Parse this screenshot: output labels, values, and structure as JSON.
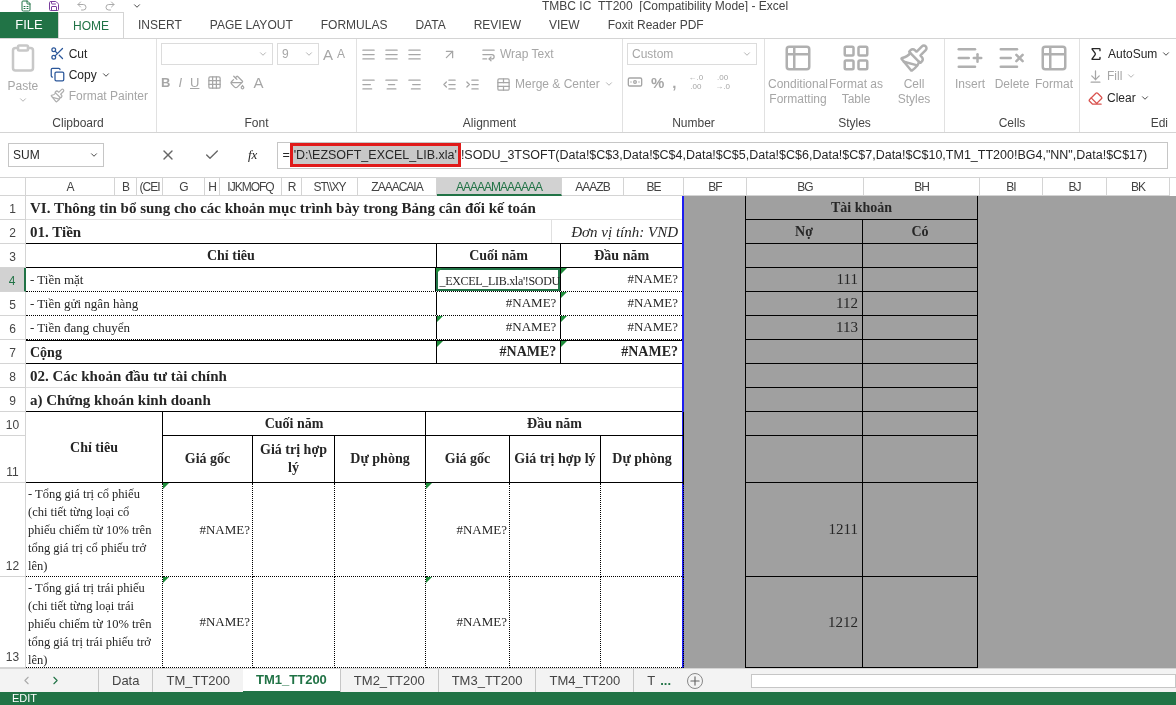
{
  "title_bar": {
    "text": "TMBC IC_TT200  [Compatibility Mode] - Excel"
  },
  "ribbon_tabs": [
    {
      "label": "FILE",
      "kind": "file",
      "selected": false
    },
    {
      "label": "HOME",
      "kind": "tab",
      "selected": true
    },
    {
      "label": "INSERT",
      "kind": "tab",
      "selected": false
    },
    {
      "label": "PAGE LAYOUT",
      "kind": "tab",
      "selected": false
    },
    {
      "label": "FORMULAS",
      "kind": "tab",
      "selected": false
    },
    {
      "label": "DATA",
      "kind": "tab",
      "selected": false
    },
    {
      "label": "REVIEW",
      "kind": "tab",
      "selected": false
    },
    {
      "label": "VIEW",
      "kind": "tab",
      "selected": false
    },
    {
      "label": "Foxit Reader PDF",
      "kind": "tab",
      "selected": false
    }
  ],
  "ribbon": {
    "clipboard": {
      "label": "Clipboard",
      "paste": {
        "label": "Paste",
        "disabled": true
      },
      "cut": {
        "label": "Cut",
        "disabled": false
      },
      "copy": {
        "label": "Copy",
        "disabled": false
      },
      "format_painter": {
        "label": "Format Painter",
        "disabled": true
      }
    },
    "font": {
      "label": "Font",
      "disabled": true,
      "font_size": "9",
      "size_buttons": [
        "A",
        "A"
      ],
      "style_buttons": [
        "B",
        "I",
        "U"
      ],
      "font_color": "A"
    },
    "alignment": {
      "label": "Alignment",
      "disabled": true,
      "wrap_text": "Wrap Text",
      "merge_center": "Merge & Center"
    },
    "number": {
      "label": "Number",
      "disabled": true,
      "format": "Custom",
      "buttons": [
        "%",
        ","
      ],
      "decimal_buttons": [
        {
          "top": "←.0",
          "bottom": ".00"
        },
        {
          "top": ".00",
          "bottom": "→.0"
        }
      ]
    },
    "styles": {
      "label": "Styles",
      "disabled": true,
      "buttons": [
        {
          "top": "Conditional",
          "bottom": "Formatting"
        },
        {
          "top": "Format as",
          "bottom": "Table"
        },
        {
          "top": "Cell",
          "bottom": "Styles"
        }
      ]
    },
    "cells": {
      "label": "Cells",
      "disabled": true,
      "buttons": [
        "Insert",
        "Delete",
        "Format"
      ]
    },
    "editing": {
      "label": "Edi",
      "autosum": {
        "label": "AutoSum",
        "disabled": false
      },
      "fill": {
        "label": "Fill",
        "disabled": true
      },
      "clear": {
        "label": "Clear",
        "disabled": false
      }
    }
  },
  "formula_bar": {
    "name_box": "SUM",
    "function_label": "fx",
    "prefix": "=",
    "highlighted": "'D:\\EZSOFT_EXCEL_LIB.xla'",
    "rest": "!SODU_3TSOFT(Data!$C$3,Data!$C$4,Data!$C$5,Data!$C$6,Data!$C$7,Data!$C$10,TM1_TT200!BG4,\"NN\",Data!$C$17)"
  },
  "column_headers": [
    {
      "label": "A",
      "selected": false
    },
    {
      "label": "B",
      "selected": false
    },
    {
      "label": "(CEI",
      "selected": false
    },
    {
      "label": "G",
      "selected": false
    },
    {
      "label": "H",
      "selected": false
    },
    {
      "label": "IJKMOFQ",
      "selected": false
    },
    {
      "label": "R",
      "selected": false
    },
    {
      "label": "ST\\\\XY",
      "selected": false
    },
    {
      "label": "ZAAACAIA",
      "selected": false
    },
    {
      "label": "AAAAAMAAAAAA",
      "selected": true
    },
    {
      "label": "AAAZB",
      "selected": false
    },
    {
      "label": "BE",
      "selected": false
    },
    {
      "label": "BF",
      "selected": false
    },
    {
      "label": "BG",
      "selected": false
    },
    {
      "label": "BH",
      "selected": false
    },
    {
      "label": "BI",
      "selected": false
    },
    {
      "label": "BJ",
      "selected": false
    },
    {
      "label": "BK",
      "selected": false
    }
  ],
  "row_headers": [
    {
      "label": "1",
      "selected": false
    },
    {
      "label": "2",
      "selected": false
    },
    {
      "label": "3",
      "selected": false
    },
    {
      "label": "4",
      "selected": true
    },
    {
      "label": "5",
      "selected": false
    },
    {
      "label": "6",
      "selected": false
    },
    {
      "label": "7",
      "selected": false
    },
    {
      "label": "8",
      "selected": false
    },
    {
      "label": "9",
      "selected": false
    },
    {
      "label": "10",
      "selected": false
    },
    {
      "label": "11",
      "selected": false
    },
    {
      "label": "12",
      "selected": false
    },
    {
      "label": "13",
      "selected": false
    }
  ],
  "sheet": {
    "title": "VI. Thông tin bổ sung cho các khoản mục trình bày trong Bảng cân đối kế toán",
    "section_1": {
      "heading": "01. Tiền",
      "unit": "Đơn vị tính: VND"
    },
    "table_1": {
      "columns": [
        "Chỉ tiêu",
        "Cuối năm",
        "Đầu năm"
      ],
      "rows": [
        {
          "label": "- Tiền mặt",
          "total": false,
          "values": [
            {
              "text": "_EXCEL_LIB.xla'!SODU",
              "selected": true,
              "flag": true
            },
            {
              "text": "#NAME?",
              "selected": false,
              "flag": true
            }
          ]
        },
        {
          "label": "- Tiền gửi ngân hàng",
          "total": false,
          "values": [
            {
              "text": "#NAME?",
              "selected": false,
              "flag": false
            },
            {
              "text": "#NAME?",
              "selected": false,
              "flag": true
            }
          ]
        },
        {
          "label": "- Tiền đang chuyển",
          "total": false,
          "values": [
            {
              "text": "#NAME?",
              "selected": false,
              "flag": true
            },
            {
              "text": "#NAME?",
              "selected": false,
              "flag": true
            }
          ]
        },
        {
          "label": "Cộng",
          "total": true,
          "values": [
            {
              "text": "#NAME?",
              "selected": false,
              "flag": true
            },
            {
              "text": "#NAME?",
              "selected": false,
              "flag": true
            }
          ]
        }
      ]
    },
    "section_2": "02. Các khoản đầu tư tài chính",
    "subsection": "a) Chứng khoán kinh doanh",
    "table_2": {
      "label_header": "Chỉ tiêu",
      "groups": [
        {
          "label": "Cuối năm",
          "columns": [
            "Giá gốc",
            "Giá trị hợp lý",
            "Dự phòng"
          ]
        },
        {
          "label": "Đầu năm",
          "columns": [
            "Giá gốc",
            "Giá trị hợp lý",
            "Dự phòng"
          ]
        }
      ],
      "rows": [
        {
          "label": "- Tổng giá trị cổ phiếu (chi tiết từng loại cổ phiếu chiếm từ 10% trên tổng giá trị cổ phiếu trở lên)",
          "cells": [
            {
              "text": "#NAME?",
              "flag": true
            },
            {
              "flag": false
            },
            {
              "flag": false
            },
            {
              "text": "#NAME?",
              "flag": true
            },
            {
              "flag": false
            },
            {
              "flag": false
            }
          ]
        },
        {
          "label": "- Tổng giá trị trái phiếu (chi tiết từng loại trái phiếu chiếm từ 10% trên tổng giá trị trái phiếu trở lên)",
          "cells": [
            {
              "text": "#NAME?",
              "flag": true
            },
            {
              "flag": false
            },
            {
              "flag": false
            },
            {
              "text": "#NAME?",
              "flag": true
            },
            {
              "flag": false
            },
            {
              "flag": false
            }
          ]
        }
      ]
    },
    "accounts": {
      "title": "Tài khoản",
      "columns": [
        "Nợ",
        "Có"
      ],
      "rows": [
        {},
        {
          "debit": "111"
        },
        {
          "debit": "112"
        },
        {
          "debit": "113"
        },
        {},
        {},
        {},
        {},
        {},
        {
          "debit": "1211"
        },
        {
          "debit": "1212"
        }
      ]
    }
  },
  "sheet_tabs": [
    {
      "label": "Data",
      "selected": false
    },
    {
      "label": "TM_TT200",
      "selected": false
    },
    {
      "label": "TM1_TT200",
      "selected": true
    },
    {
      "label": "TM2_TT200",
      "selected": false
    },
    {
      "label": "TM3_TT200",
      "selected": false
    },
    {
      "label": "TM4_TT200",
      "selected": false
    },
    {
      "label": "T",
      "selected": false
    }
  ],
  "more_tabs": "...",
  "status_bar": {
    "mode": "EDIT"
  }
}
